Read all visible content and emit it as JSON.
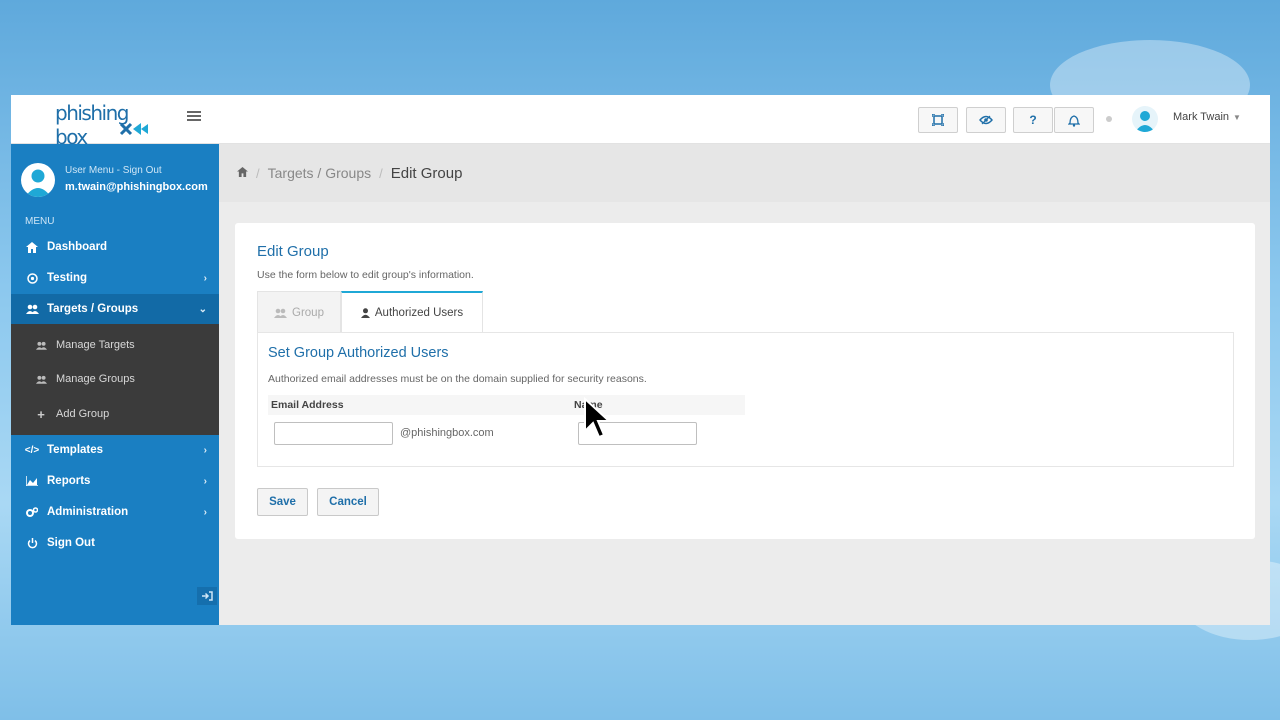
{
  "app": {
    "logo_text": "phishing box"
  },
  "topbar": {
    "user_name": "Mark Twain",
    "buttons": [
      "fullscreen-icon",
      "eye-icon",
      "question-icon",
      "bell-icon"
    ]
  },
  "sidebar": {
    "user_menu_label": "User Menu - Sign Out",
    "email": "m.twain@phishingbox.com",
    "menu_label": "MENU",
    "items": [
      {
        "label": "Dashboard",
        "icon": "home-icon"
      },
      {
        "label": "Testing",
        "icon": "target-icon"
      },
      {
        "label": "Targets / Groups",
        "icon": "users-icon"
      },
      {
        "label": "Templates",
        "icon": "code-icon"
      },
      {
        "label": "Reports",
        "icon": "chart-icon"
      },
      {
        "label": "Administration",
        "icon": "cogs-icon"
      },
      {
        "label": "Sign Out",
        "icon": "power-icon"
      }
    ],
    "submenu": [
      {
        "label": "Manage Targets",
        "icon": "users-icon"
      },
      {
        "label": "Manage Groups",
        "icon": "users-icon"
      },
      {
        "label": "Add Group",
        "icon": "plus-icon"
      }
    ]
  },
  "breadcrumb": {
    "parent": "Targets / Groups",
    "current": "Edit Group"
  },
  "panel": {
    "title": "Edit Group",
    "subtitle": "Use the form below to edit group's information.",
    "tabs": [
      {
        "label": "Group",
        "active": false
      },
      {
        "label": "Authorized Users",
        "active": true
      }
    ],
    "section_title": "Set Group Authorized Users",
    "section_subtitle": "Authorized email addresses must be on the domain supplied for security reasons.",
    "columns": [
      "Email Address",
      "Name"
    ],
    "email_value": "",
    "domain_suffix": "@phishingbox.com",
    "name_value": "",
    "save_label": "Save",
    "cancel_label": "Cancel"
  },
  "colors": {
    "sidebar": "#1a7fc2",
    "submenu": "#3b3b3b",
    "accent": "#1f6fa9",
    "tab_active_border": "#1fa8d6"
  }
}
